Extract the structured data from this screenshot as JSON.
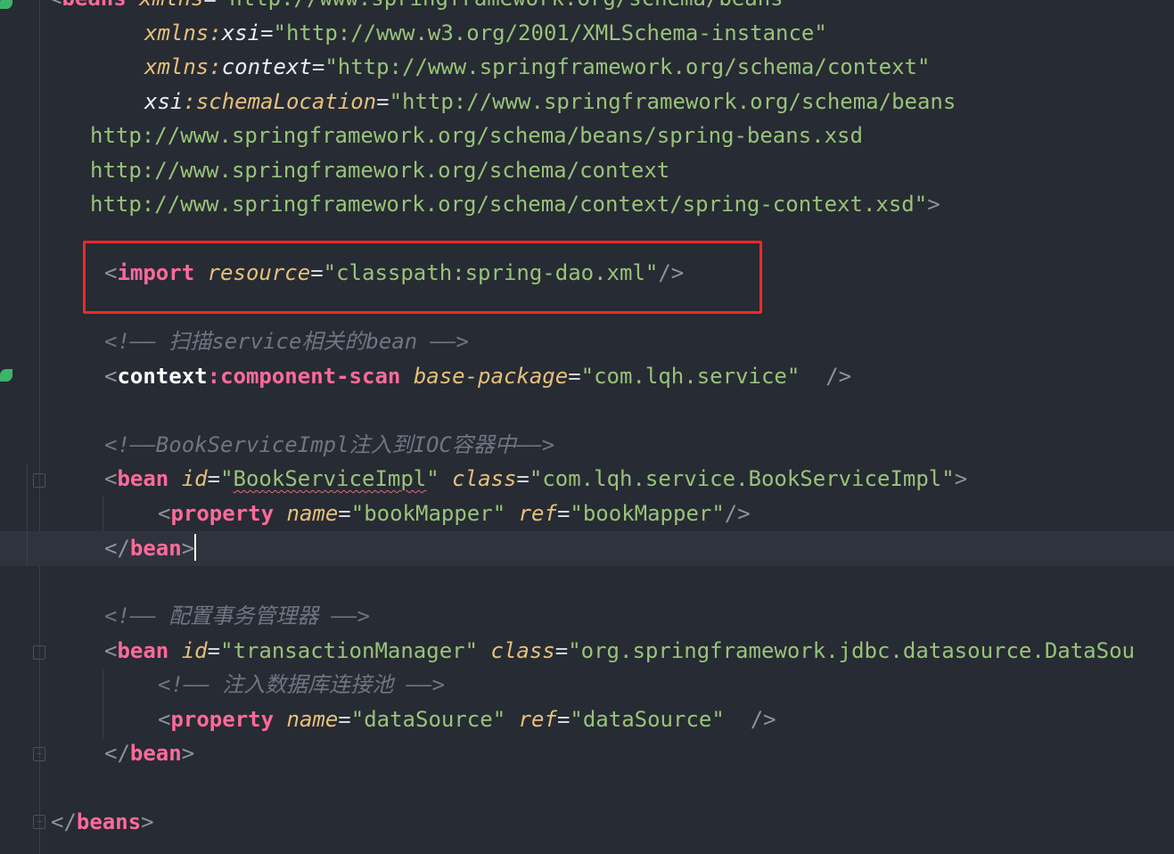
{
  "editor": {
    "lines": {
      "l0": {
        "tag": "beans",
        "attr": "xmlns",
        "value": "\"http://www.springframework.org/schema/beans\""
      },
      "l1": {
        "ns_prefix": "xmlns",
        "ns_name": "xsi",
        "value": "\"http://www.w3.org/2001/XMLSchema-instance\""
      },
      "l2": {
        "ns_prefix": "xmlns",
        "ns_name": "context",
        "value": "\"http://www.springframework.org/schema/context\""
      },
      "l3": {
        "ns_prefix": "xsi",
        "ns_name": "schemaLocation",
        "value": "\"http://www.springframework.org/schema/beans"
      },
      "l4": {
        "value": "http://www.springframework.org/schema/beans/spring-beans.xsd"
      },
      "l5": {
        "value": "http://www.springframework.org/schema/context"
      },
      "l6": {
        "value": "http://www.springframework.org/schema/context/spring-context.xsd\""
      },
      "l8": {
        "tag": "import",
        "attr": "resource",
        "value": "\"classpath:spring-dao.xml\""
      },
      "l9": {
        "comment": "扫描service相关的bean"
      },
      "l10": {
        "prefix": "context",
        "tag": "component-scan",
        "attr": "base-package",
        "value": "\"com.lqh.service\""
      },
      "l12": {
        "comment": "BookServiceImpl注入到IOC容器中"
      },
      "l13": {
        "tag": "bean",
        "attr1": "id",
        "value1": "BookServiceImpl",
        "attr2": "class",
        "value2": "\"com.lqh.service.BookServiceImpl\""
      },
      "l14": {
        "tag": "property",
        "attr1": "name",
        "value1": "\"bookMapper\"",
        "attr2": "ref",
        "value2": "\"bookMapper\""
      },
      "l15": {
        "tag": "bean"
      },
      "l17": {
        "comment": "配置事务管理器"
      },
      "l18": {
        "tag": "bean",
        "attr1": "id",
        "value1": "\"transactionManager\"",
        "attr2": "class",
        "value2": "\"org.springframework.jdbc.datasource.DataSou"
      },
      "l19": {
        "comment": "注入数据库连接池"
      },
      "l20": {
        "tag": "property",
        "attr1": "name",
        "value1": "\"dataSource\"",
        "attr2": "ref",
        "value2": "\"dataSource\""
      },
      "l21": {
        "tag": "bean"
      },
      "l23": {
        "tag": "beans"
      }
    }
  }
}
